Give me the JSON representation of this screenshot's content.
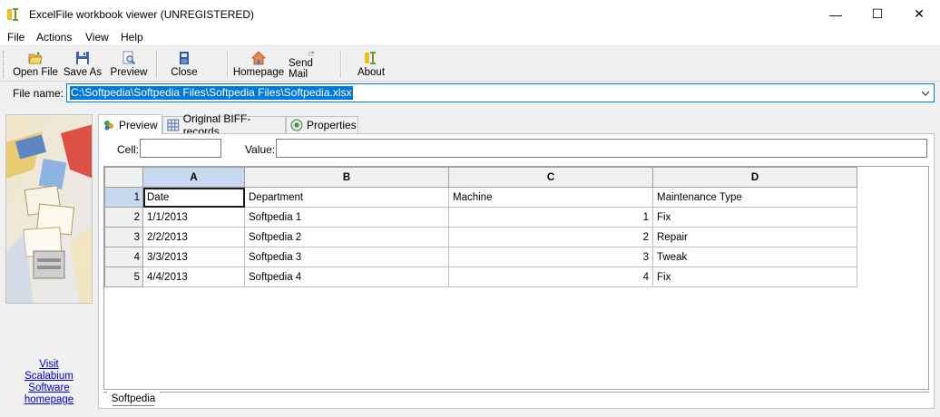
{
  "window": {
    "title": "ExcelFile workbook viewer (UNREGISTERED)",
    "minimize_glyph": "—",
    "maximize_glyph": "☐",
    "close_glyph": "✕"
  },
  "menu": [
    "File",
    "Actions",
    "View",
    "Help"
  ],
  "toolbar": {
    "buttons": [
      {
        "label": "Open File",
        "icon": "open-folder-icon"
      },
      {
        "label": "Save As",
        "icon": "floppy-disk-icon"
      },
      {
        "label": "Preview",
        "icon": "preview-icon"
      },
      {
        "label": "Close",
        "icon": "close-document-icon"
      },
      {
        "label": "Homepage",
        "icon": "home-icon"
      },
      {
        "label": "Send Mail",
        "icon": "mail-icon"
      },
      {
        "label": "About",
        "icon": "about-icon"
      }
    ]
  },
  "file": {
    "label": "File name:",
    "value": "C:\\Softpedia\\Softpedia Files\\Softpedia Files\\Softpedia.xlsx"
  },
  "left_panel": {
    "link_lines": [
      "Visit",
      "Scalabium Software",
      "homepage"
    ]
  },
  "tabs": [
    {
      "label": "Preview",
      "icon": "preview-tab-icon",
      "active": true
    },
    {
      "label": "Original BIFF-records",
      "icon": "grid-icon",
      "active": false
    },
    {
      "label": "Properties",
      "icon": "properties-icon",
      "active": false
    }
  ],
  "cell_editor": {
    "cell_label": "Cell:",
    "cell_value": "",
    "value_label": "Value:",
    "value_value": ""
  },
  "sheet": {
    "columns": [
      "A",
      "B",
      "C",
      "D"
    ],
    "rows": [
      {
        "num": "1",
        "cells": [
          "Date",
          "Department",
          "Machine",
          "Maintenance Type"
        ]
      },
      {
        "num": "2",
        "cells": [
          "1/1/2013",
          "Softpedia 1",
          "1",
          "Fix"
        ]
      },
      {
        "num": "3",
        "cells": [
          "2/2/2013",
          "Softpedia 2",
          "2",
          "Repair"
        ]
      },
      {
        "num": "4",
        "cells": [
          "3/3/2013",
          "Softpedia 3",
          "3",
          "Tweak"
        ]
      },
      {
        "num": "5",
        "cells": [
          "4/4/2013",
          "Softpedia 4",
          "4",
          "Fix"
        ]
      }
    ],
    "tab_name": "Softpedia"
  },
  "colors": {
    "selection": "#0078d7",
    "header_selected": "#c8d8ef",
    "link": "#0000cc"
  }
}
